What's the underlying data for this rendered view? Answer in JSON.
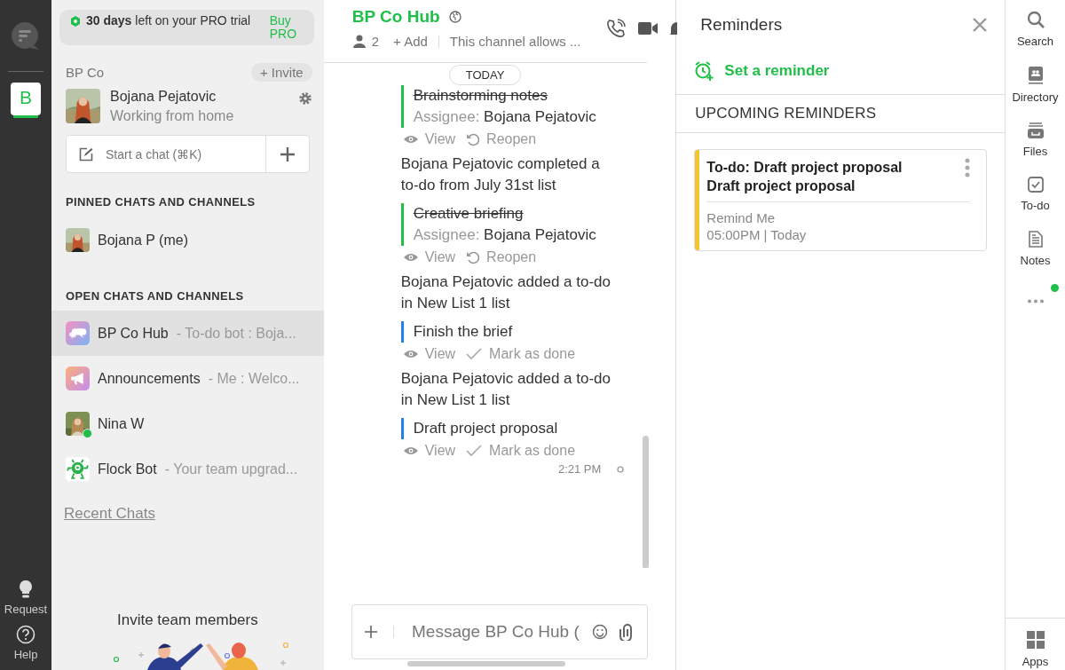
{
  "rail": {
    "teams": [
      {
        "letter": "B",
        "selected": true
      }
    ],
    "bottom": [
      {
        "kind": "request",
        "label": "Request"
      },
      {
        "kind": "help",
        "label": "Help"
      }
    ]
  },
  "sidebar": {
    "trial": {
      "text": "**30 days** left on your PRO trial",
      "link": "Buy PRO"
    },
    "team_name": "BP Co",
    "invite": "+ Invite",
    "profile": {
      "name": "Bojana Pejatovic",
      "status": "Working from home"
    },
    "start_chat": {
      "placeholder": "Start a chat (⌘K)"
    },
    "pinned_heading": "PINNED CHATS AND CHANNELS",
    "pinned": [
      {
        "name": "Bojana P (me)",
        "online": false,
        "selected": false
      }
    ],
    "open_heading": "OPEN CHATS AND CHANNELS",
    "open": [
      {
        "name": "BP Co Hub",
        "preview": "- To-do bot : Boja...",
        "kind": "hub",
        "online": false,
        "selected": true
      },
      {
        "name": "Announcements",
        "preview": "- Me : Welco...",
        "kind": "megaphone",
        "online": false,
        "selected": false
      },
      {
        "name": "Nina W",
        "online": true,
        "selected": false
      },
      {
        "name": "Flock Bot",
        "preview": "- Your team upgrad...",
        "kind": "bot",
        "online": false,
        "selected": false
      }
    ],
    "recent_link": "Recent Chats",
    "invite_heading": "Invite team members"
  },
  "channel": {
    "title": "BP Co Hub",
    "members": "2",
    "add": "+ Add",
    "description": "This channel allows ...",
    "date_pill": "TODAY",
    "messages": [
      {
        "kind": "todo",
        "title": "Brainstorming notes",
        "done": true,
        "assignee_label": "Assignee:",
        "assignee": "Bojana Pejatovic",
        "actions": [
          "View",
          "Reopen"
        ]
      },
      {
        "kind": "event",
        "text": "Bojana Pejatovic completed a to-do from July 31st list"
      },
      {
        "kind": "todo",
        "title": "Creative briefing",
        "done": true,
        "assignee_label": "Assignee:",
        "assignee": "Bojana Pejatovic",
        "actions": [
          "View",
          "Reopen"
        ]
      },
      {
        "kind": "event",
        "text": "Bojana Pejatovic added a to-do in New List 1 list"
      },
      {
        "kind": "todo",
        "title": "Finish the brief",
        "done": false,
        "actions": [
          "View",
          "Mark as done"
        ]
      },
      {
        "kind": "event",
        "text": "Bojana Pejatovic added a to-do in New List 1 list"
      },
      {
        "kind": "todo",
        "title": "Draft project proposal",
        "done": false,
        "actions": [
          "View",
          "Mark as done"
        ]
      }
    ],
    "time": "2:21 PM",
    "composer": {
      "placeholder": "Message BP Co Hub ("
    }
  },
  "reminders": {
    "title": "Reminders",
    "set": "Set a reminder",
    "heading": "UPCOMING REMINDERS",
    "items": [
      {
        "title": "To-do: Draft project proposal",
        "subtitle": "Draft project proposal",
        "label": "Remind Me",
        "when": "05:00PM | Today",
        "color": "#f5c431"
      }
    ]
  },
  "apps": {
    "items": [
      {
        "kind": "search",
        "label": "Search"
      },
      {
        "kind": "directory",
        "label": "Directory"
      },
      {
        "kind": "files",
        "label": "Files"
      },
      {
        "kind": "todo",
        "label": "To-do"
      },
      {
        "kind": "notes",
        "label": "Notes"
      }
    ],
    "more_notification": true,
    "bottom": {
      "label": "Apps"
    }
  }
}
